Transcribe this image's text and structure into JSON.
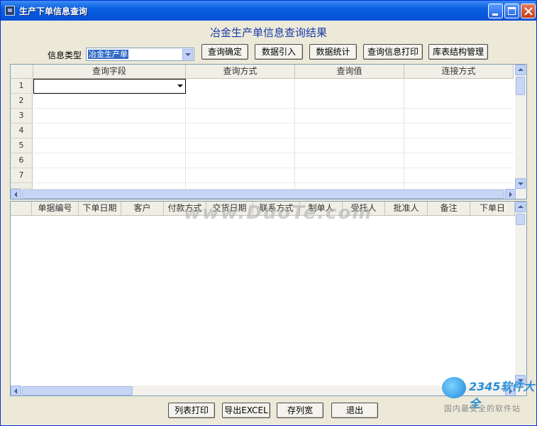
{
  "window": {
    "title": "生产下单信息查询"
  },
  "heading": "冶金生产单信息查询结果",
  "info_type": {
    "label": "信息类型",
    "value": "冶金生产单"
  },
  "toolbar": [
    {
      "label": "查询确定"
    },
    {
      "label": "数据引入"
    },
    {
      "label": "数据统计"
    },
    {
      "label": "查询信息打印"
    },
    {
      "label": "库表结构管理"
    }
  ],
  "query_grid": {
    "columns": [
      "查询字段",
      "查询方式",
      "查询值",
      "连接方式"
    ],
    "rows": [
      "1",
      "2",
      "3",
      "4",
      "5",
      "6",
      "7"
    ]
  },
  "results_grid": {
    "columns": [
      "单据编号",
      "下单日期",
      "客户",
      "付款方式",
      "交货日期",
      "联系方式",
      "制单人",
      "受托人",
      "批准人",
      "备注",
      "下单日"
    ]
  },
  "bottom_buttons": [
    {
      "label": "列表打印"
    },
    {
      "label": "导出EXCEL"
    },
    {
      "label": "存列宽"
    },
    {
      "label": "退出"
    }
  ],
  "watermark": "www.DuoTe.com",
  "logo": {
    "text": "2345软件大全",
    "subtitle": "国内最安全的软件站"
  },
  "icons": [
    "app-icon",
    "minimize-icon",
    "maximize-icon",
    "close-icon",
    "chevron-down-icon"
  ]
}
